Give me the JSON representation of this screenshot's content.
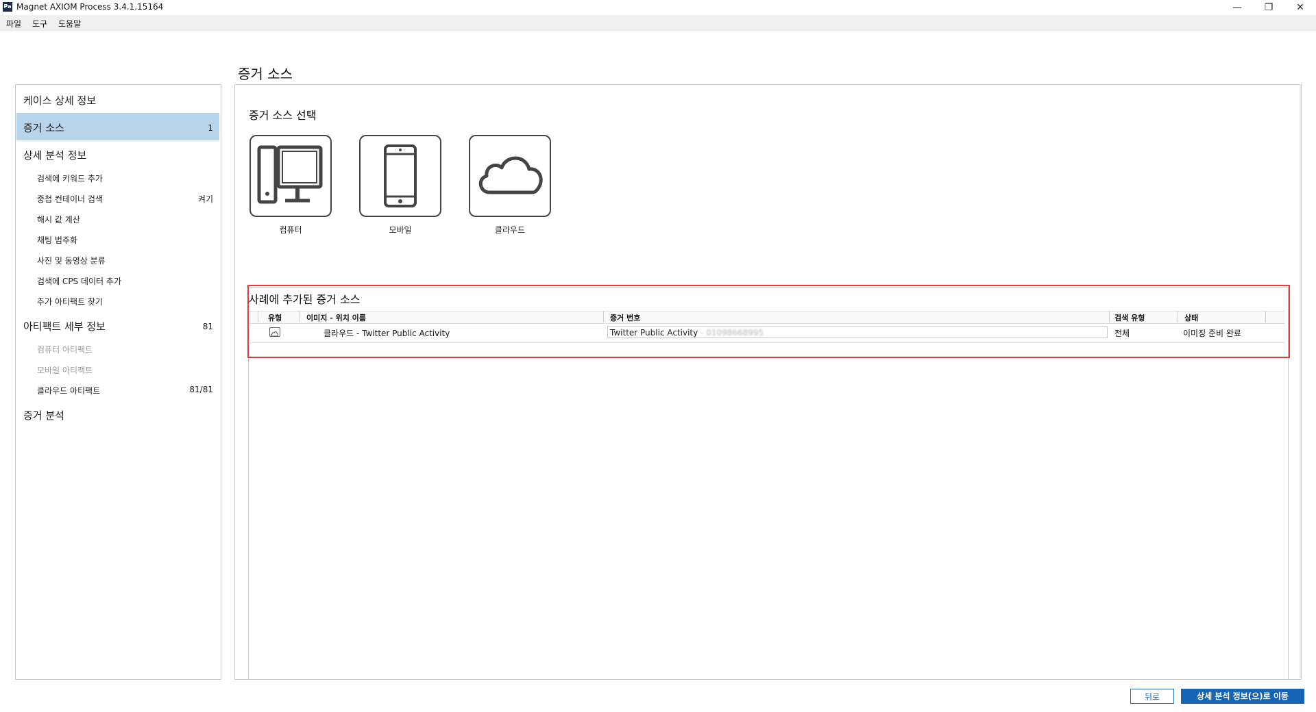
{
  "window": {
    "app_icon_text": "Pa",
    "title": "Magnet AXIOM Process 3.4.1.15164",
    "minimize": "—",
    "restore": "❐",
    "close": "✕"
  },
  "menu": [
    "파일",
    "도구",
    "도움말"
  ],
  "page_title": "증거 소스",
  "sidebar": {
    "items": [
      {
        "label": "케이스 상세 정보",
        "count": ""
      },
      {
        "label": "증거 소스",
        "count": "1"
      },
      {
        "label": "상세 분석 정보",
        "count": ""
      },
      {
        "label": "검색에 키워드 추가",
        "count": ""
      },
      {
        "label": "중첩 컨테이너 검색",
        "count": "켜기"
      },
      {
        "label": "해시 값 계산",
        "count": ""
      },
      {
        "label": "채팅 범주화",
        "count": ""
      },
      {
        "label": "사진 및 동영상 분류",
        "count": ""
      },
      {
        "label": "검색에 CPS 데이터 추가",
        "count": ""
      },
      {
        "label": "추가 아티팩트 찾기",
        "count": ""
      },
      {
        "label": "아티팩트 세부 정보",
        "count": "81"
      },
      {
        "label": "컴퓨터 아티팩트",
        "count": ""
      },
      {
        "label": "모바일 아티팩트",
        "count": ""
      },
      {
        "label": "클라우드 아티팩트",
        "count": "81/81"
      },
      {
        "label": "증거 분석",
        "count": ""
      }
    ]
  },
  "select_section": {
    "title": "증거 소스 선택",
    "tiles": [
      {
        "label": "컴퓨터",
        "icon": "computer-icon"
      },
      {
        "label": "모바일",
        "icon": "mobile-icon"
      },
      {
        "label": "클라우드",
        "icon": "cloud-icon"
      }
    ]
  },
  "added_section": {
    "title": "사례에 추가된 증거 소스",
    "columns": [
      "유형",
      "이미지 - 위치 이름",
      "증거 번호",
      "검색 유형",
      "상태"
    ],
    "rows": [
      {
        "type_icon": "cloud-icon",
        "image_location": "클라우드 - Twitter Public Activity",
        "evidence_number": "Twitter Public Activity",
        "evidence_number_suffix": " - 01098668995",
        "search_type": "전체",
        "status": "이미징 준비 완료"
      }
    ]
  },
  "buttons": {
    "back": "뒤로",
    "next": "상세 분석 정보(으)로 이동"
  },
  "colors": {
    "selection": "#b8d4ea",
    "highlight_border": "#e03a3a",
    "primary_button": "#1764b5"
  }
}
